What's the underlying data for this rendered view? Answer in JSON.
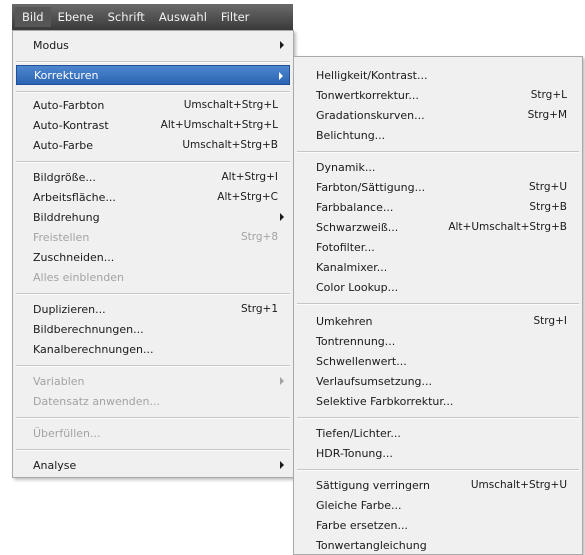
{
  "menubar": {
    "items": [
      "Bild",
      "Ebene",
      "Schrift",
      "Auswahl",
      "Filter"
    ]
  },
  "main_menu": {
    "items": [
      {
        "label": "Modus",
        "shortcut": "",
        "submenu": true,
        "disabled": false
      },
      {
        "label": "Korrekturen",
        "shortcut": "",
        "submenu": true,
        "disabled": false,
        "highlighted": true
      },
      {
        "label": "Auto-Farbton",
        "shortcut": "Umschalt+Strg+L",
        "submenu": false,
        "disabled": false
      },
      {
        "label": "Auto-Kontrast",
        "shortcut": "Alt+Umschalt+Strg+L",
        "submenu": false,
        "disabled": false
      },
      {
        "label": "Auto-Farbe",
        "shortcut": "Umschalt+Strg+B",
        "submenu": false,
        "disabled": false
      },
      {
        "label": "Bildgröße...",
        "shortcut": "Alt+Strg+I",
        "submenu": false,
        "disabled": false
      },
      {
        "label": "Arbeitsfläche...",
        "shortcut": "Alt+Strg+C",
        "submenu": false,
        "disabled": false
      },
      {
        "label": "Bilddrehung",
        "shortcut": "",
        "submenu": true,
        "disabled": false
      },
      {
        "label": "Freistellen",
        "shortcut": "Strg+8",
        "submenu": false,
        "disabled": true
      },
      {
        "label": "Zuschneiden...",
        "shortcut": "",
        "submenu": false,
        "disabled": false
      },
      {
        "label": "Alles einblenden",
        "shortcut": "",
        "submenu": false,
        "disabled": true
      },
      {
        "label": "Duplizieren...",
        "shortcut": "Strg+1",
        "submenu": false,
        "disabled": false
      },
      {
        "label": "Bildberechnungen...",
        "shortcut": "",
        "submenu": false,
        "disabled": false
      },
      {
        "label": "Kanalberechnungen...",
        "shortcut": "",
        "submenu": false,
        "disabled": false
      },
      {
        "label": "Variablen",
        "shortcut": "",
        "submenu": true,
        "disabled": true
      },
      {
        "label": "Datensatz anwenden...",
        "shortcut": "",
        "submenu": false,
        "disabled": true
      },
      {
        "label": "Überfüllen...",
        "shortcut": "",
        "submenu": false,
        "disabled": true
      },
      {
        "label": "Analyse",
        "shortcut": "",
        "submenu": true,
        "disabled": false
      }
    ]
  },
  "sub_menu": {
    "items": [
      {
        "label": "Helligkeit/Kontrast...",
        "shortcut": ""
      },
      {
        "label": "Tonwertkorrektur...",
        "shortcut": "Strg+L"
      },
      {
        "label": "Gradationskurven...",
        "shortcut": "Strg+M"
      },
      {
        "label": "Belichtung...",
        "shortcut": ""
      },
      {
        "label": "Dynamik...",
        "shortcut": ""
      },
      {
        "label": "Farbton/Sättigung...",
        "shortcut": "Strg+U"
      },
      {
        "label": "Farbbalance...",
        "shortcut": "Strg+B"
      },
      {
        "label": "Schwarzweiß...",
        "shortcut": "Alt+Umschalt+Strg+B"
      },
      {
        "label": "Fotofilter...",
        "shortcut": ""
      },
      {
        "label": "Kanalmixer...",
        "shortcut": ""
      },
      {
        "label": "Color Lookup...",
        "shortcut": ""
      },
      {
        "label": "Umkehren",
        "shortcut": "Strg+I"
      },
      {
        "label": "Tontrennung...",
        "shortcut": ""
      },
      {
        "label": "Schwellenwert...",
        "shortcut": ""
      },
      {
        "label": "Verlaufsumsetzung...",
        "shortcut": ""
      },
      {
        "label": "Selektive Farbkorrektur...",
        "shortcut": ""
      },
      {
        "label": "Tiefen/Lichter...",
        "shortcut": ""
      },
      {
        "label": "HDR-Tonung...",
        "shortcut": ""
      },
      {
        "label": "Sättigung verringern",
        "shortcut": "Umschalt+Strg+U"
      },
      {
        "label": "Gleiche Farbe...",
        "shortcut": ""
      },
      {
        "label": "Farbe ersetzen...",
        "shortcut": ""
      },
      {
        "label": "Tonwertangleichung",
        "shortcut": ""
      }
    ]
  },
  "colors": {
    "menubar": "#4a4a4a",
    "menu_bg": "#f0f0f0",
    "highlight": "#2f6bbd",
    "disabled_text": "#a3a3a3"
  }
}
